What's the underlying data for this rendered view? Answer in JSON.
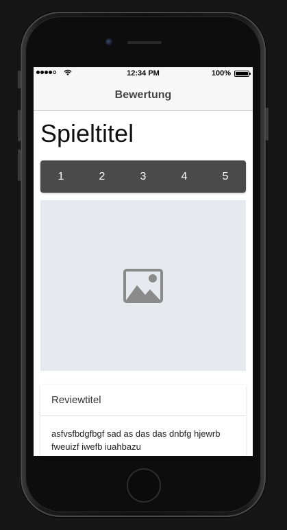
{
  "status_bar": {
    "time": "12:34 PM",
    "battery_percent": "100%",
    "signal_bars": 4,
    "icons": [
      "signal-icon",
      "wifi-icon",
      "battery-icon"
    ]
  },
  "nav_bar": {
    "title": "Bewertung"
  },
  "game": {
    "title": "Spieltitel",
    "image_icon": "image-placeholder-icon"
  },
  "rating": {
    "options": [
      "1",
      "2",
      "3",
      "4",
      "5"
    ]
  },
  "review": {
    "title": "Reviewtitel",
    "body": "asfvsfbdgfbgf sad as das das dnbfg hjewrb fweuizf iwefb iuahbazu"
  },
  "colors": {
    "rating_bar": "#4a4a4a",
    "image_placeholder_bg": "#e6e9ee",
    "nav_bar_bg": "#f7f7f7"
  }
}
